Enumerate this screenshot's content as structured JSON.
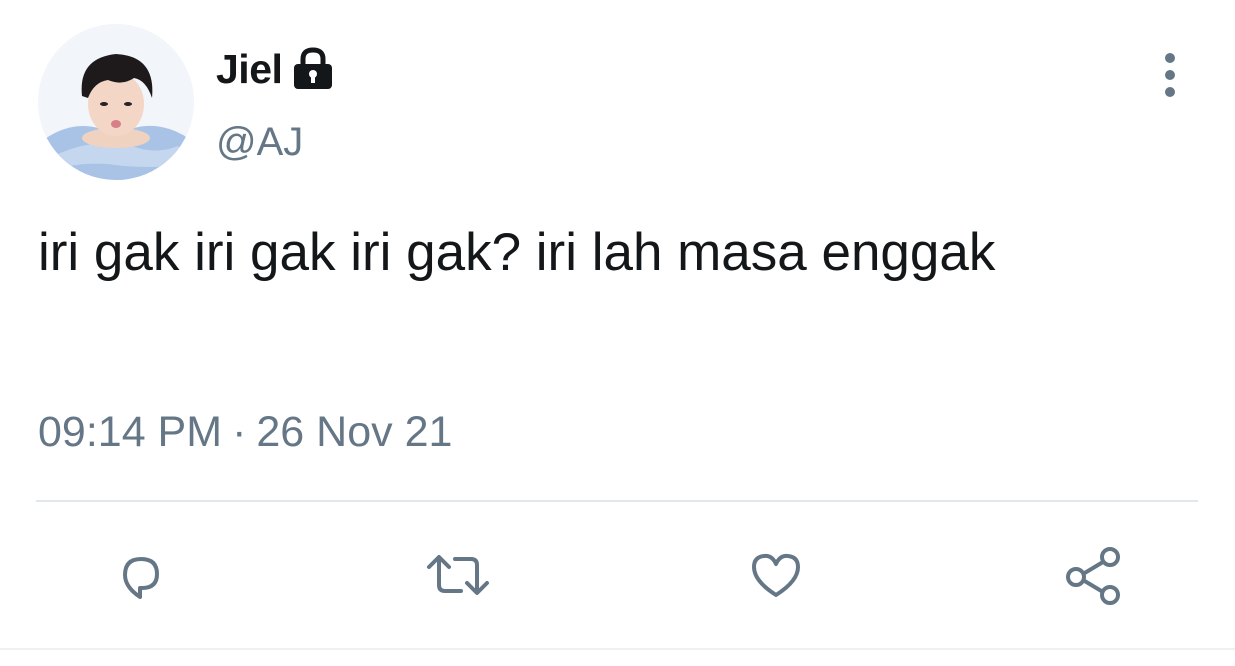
{
  "user": {
    "display_name": "Jiel",
    "handle": "@AJ",
    "protected_icon": "lock-icon",
    "avatar": "profile-photo"
  },
  "tweet": {
    "text": "iri gak iri gak iri gak? iri lah masa enggak",
    "time": "09:14 PM",
    "separator": "·",
    "date": "26 Nov 21"
  },
  "actions": [
    {
      "name": "reply",
      "icon": "reply-icon"
    },
    {
      "name": "retweet",
      "icon": "retweet-icon"
    },
    {
      "name": "like",
      "icon": "heart-icon"
    },
    {
      "name": "share",
      "icon": "share-icon"
    }
  ],
  "menu": {
    "icon": "more-vertical-icon"
  },
  "colors": {
    "text": "#14171a",
    "secondary": "#657786",
    "divider": "#e1e8ed"
  }
}
